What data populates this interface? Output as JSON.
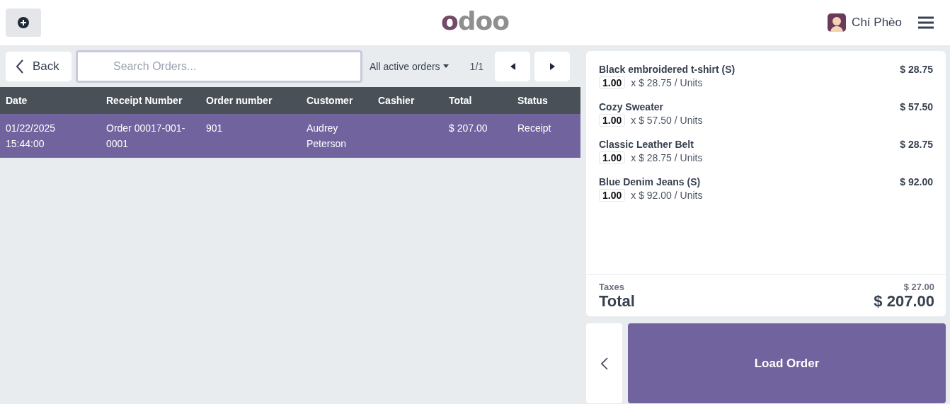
{
  "header": {
    "logo": "odoo",
    "user": "Chí Phèo"
  },
  "toolbar": {
    "back": "Back",
    "search": {
      "placeholder": "Search Orders..."
    },
    "filter": "All active orders",
    "page": "1/1"
  },
  "table": {
    "columns": [
      "Date",
      "Receipt Number",
      "Order number",
      "Customer",
      "Cashier",
      "Total",
      "Status"
    ],
    "rows": [
      {
        "selected": true,
        "cells": [
          "01/22/2025 15:44:00",
          "Order 00017-001-0001",
          "901",
          "Audrey Peterson",
          "",
          "$ 207.00",
          "Receipt"
        ]
      }
    ]
  },
  "order": {
    "lines": [
      {
        "name": "Black embroidered t-shirt (S)",
        "price": "$ 28.75",
        "qty": "1.00",
        "unit": "x $ 28.75 / Units"
      },
      {
        "name": "Cozy Sweater",
        "price": "$ 57.50",
        "qty": "1.00",
        "unit": "x $ 57.50 / Units"
      },
      {
        "name": "Classic Leather Belt",
        "price": "$ 28.75",
        "qty": "1.00",
        "unit": "x $ 28.75 / Units"
      },
      {
        "name": "Blue Denim Jeans (S)",
        "price": "$ 92.00",
        "qty": "1.00",
        "unit": "x $ 92.00 / Units"
      }
    ],
    "taxes_label": "Taxes",
    "taxes": "$ 27.00",
    "total_label": "Total",
    "total": "$ 207.00"
  },
  "actions": {
    "load": "Load Order"
  }
}
